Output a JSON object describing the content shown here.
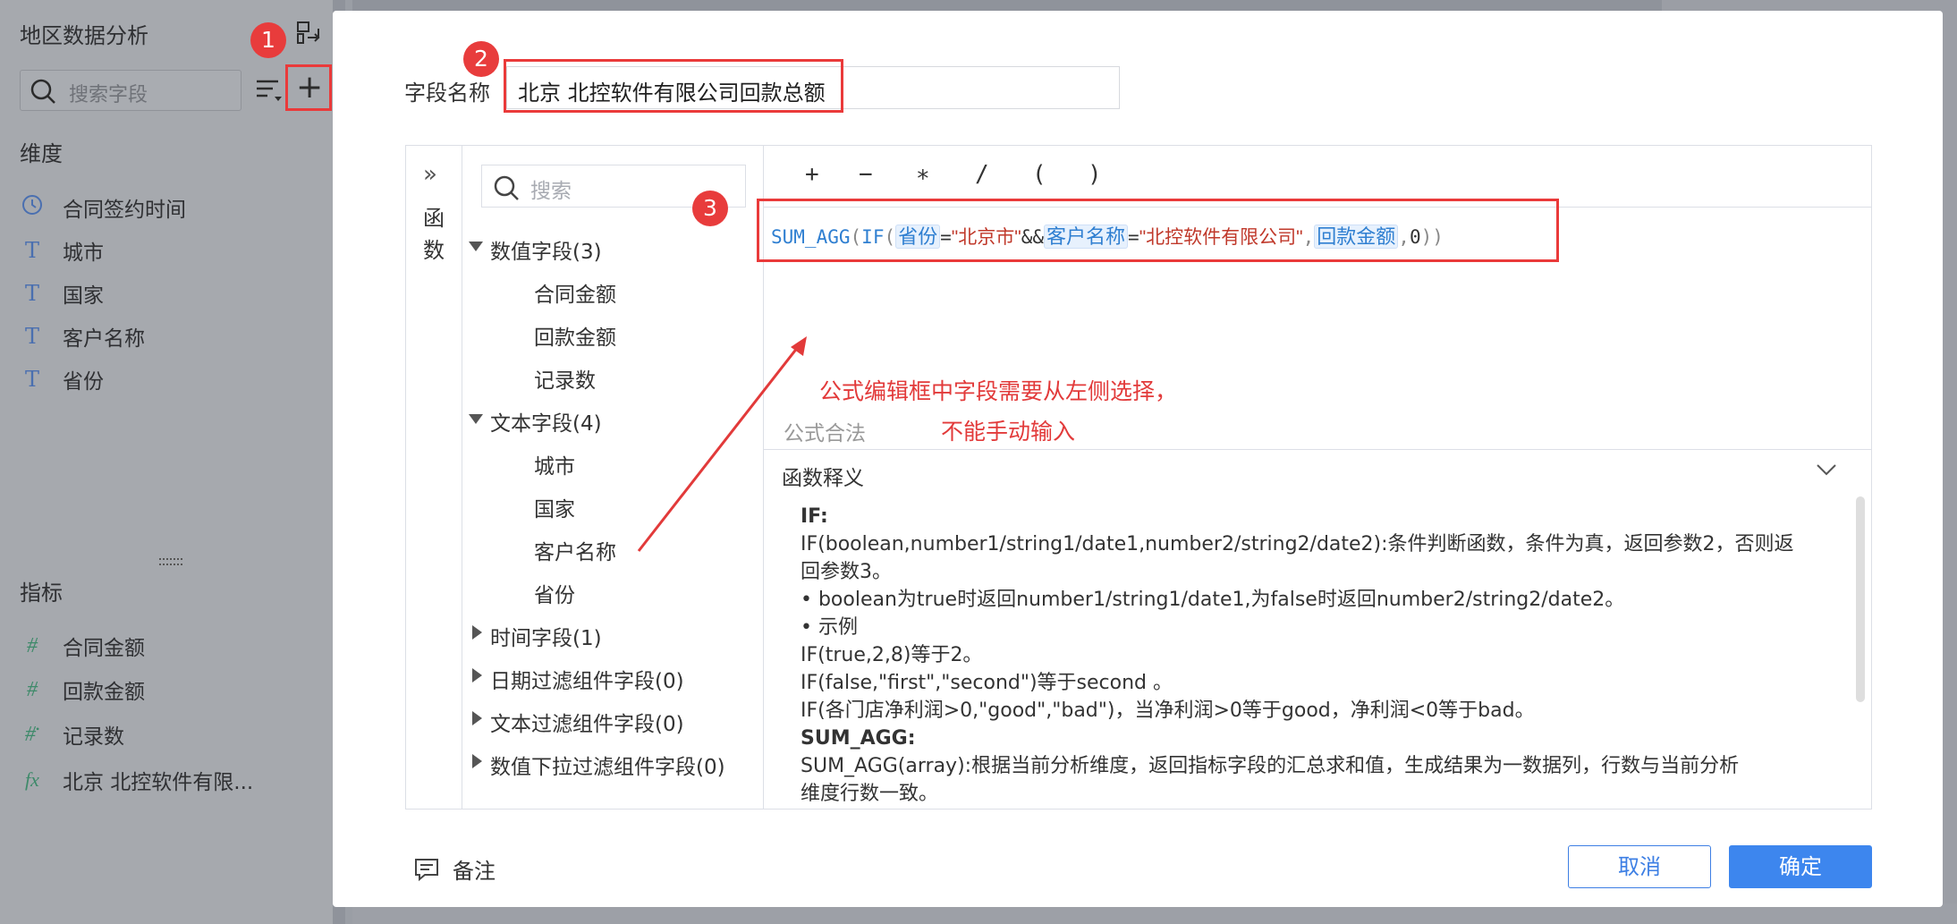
{
  "panel": {
    "title": "地区数据分析",
    "search_placeholder": "搜索字段",
    "dimension_header": "维度",
    "dimensions": [
      {
        "icon": "clock-icon",
        "label": "合同签约时间"
      },
      {
        "icon": "text-type-icon",
        "label": "城市"
      },
      {
        "icon": "text-type-icon",
        "label": "国家"
      },
      {
        "icon": "text-type-icon",
        "label": "客户名称"
      },
      {
        "icon": "text-type-icon",
        "label": "省份"
      }
    ],
    "metric_header": "指标",
    "metrics": [
      {
        "icon": "number-type-icon",
        "label": "合同金额"
      },
      {
        "icon": "number-type-icon",
        "label": "回款金额"
      },
      {
        "icon": "count-type-icon",
        "label": "记录数"
      },
      {
        "icon": "formula-type-icon",
        "label": "北京 北控软件有限..."
      }
    ]
  },
  "badges": [
    "1",
    "2",
    "3"
  ],
  "dialog": {
    "field_name_label": "字段名称",
    "field_name_value": "北京 北控软件有限公司回款总额",
    "side_label_1": "函",
    "side_label_2": "数",
    "tree_search_placeholder": "搜索",
    "tree": {
      "numeric_group": "数值字段(3)",
      "numeric": [
        "合同金额",
        "回款金额",
        "记录数"
      ],
      "text_group": "文本字段(4)",
      "text": [
        "城市",
        "国家",
        "客户名称",
        "省份"
      ],
      "time_group": "时间字段(1)",
      "date_filter_group": "日期过滤组件字段(0)",
      "text_filter_group": "文本过滤组件字段(0)",
      "num_filter_group": "数值下拉过滤组件字段(0)"
    },
    "operators": [
      "+",
      "−",
      "∗",
      "/",
      "(",
      ")"
    ],
    "formula": {
      "fn1": "SUM_AGG",
      "fn2": "IF",
      "tok_province": "省份",
      "str_beijing": "\"北京市\"",
      "and_op": "&&",
      "tok_customer": "客户名称",
      "str_company": "\"北控软件有限公司\"",
      "tok_amount": "回款金额",
      "zero": "0"
    },
    "annotation_line1": "公式编辑框中字段需要从左侧选择，",
    "annotation_line2": "不能手动输入",
    "formula_status": "公式合法",
    "explain_header": "函数释义",
    "explain": [
      {
        "bold": true,
        "text": "IF:"
      },
      {
        "bold": false,
        "text": "IF(boolean,number1/string1/date1,number2/string2/date2):条件判断函数，条件为真，返回参数2，否则返"
      },
      {
        "bold": false,
        "text": "回参数3。"
      },
      {
        "bold": false,
        "text": "• boolean为true时返回number1/string1/date1,为false时返回number2/string2/date2。"
      },
      {
        "bold": false,
        "text": "• 示例"
      },
      {
        "bold": false,
        "text": "IF(true,2,8)等于2。"
      },
      {
        "bold": false,
        "text": "IF(false,\"first\",\"second\")等于second 。"
      },
      {
        "bold": false,
        "text": "IF(各门店净利润>0,\"good\",\"bad\")，当净利润>0等于good，净利润<0等于bad。"
      },
      {
        "bold": true,
        "text": "SUM_AGG:"
      },
      {
        "bold": false,
        "text": "SUM_AGG(array):根据当前分析维度，返回指标字段的汇总求和值，生成结果为一数据列，行数与当前分析"
      },
      {
        "bold": false,
        "text": "维度行数一致。"
      }
    ],
    "note_label": "备注",
    "cancel_label": "取消",
    "ok_label": "确定"
  },
  "colors": {
    "accent": "#3d86ee",
    "highlight": "#ea3a3a"
  }
}
